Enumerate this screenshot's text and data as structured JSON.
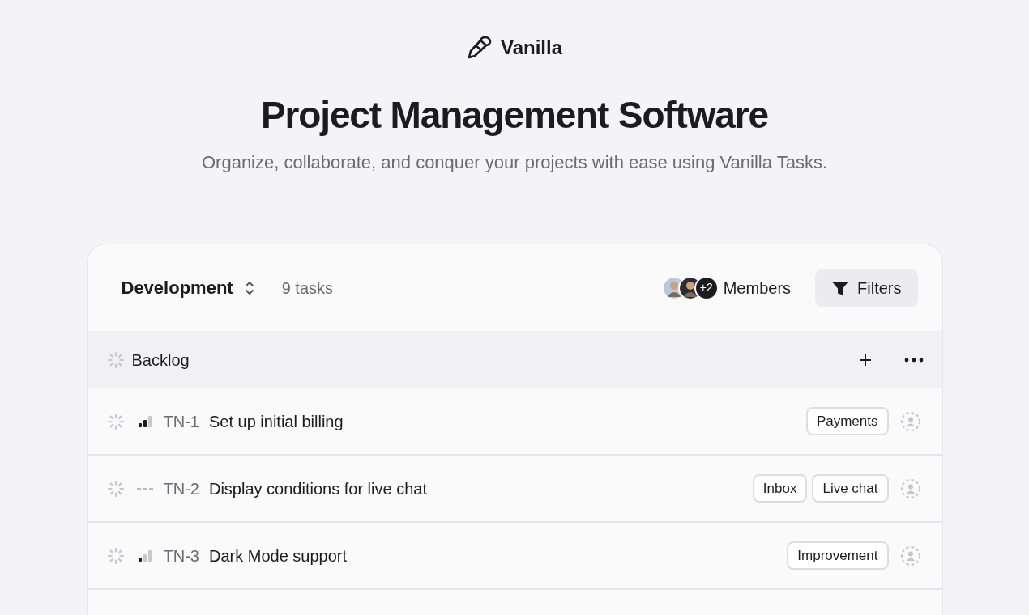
{
  "brand": {
    "name": "Vanilla"
  },
  "hero": {
    "title": "Project Management Software",
    "subtitle": "Organize, collaborate, and conquer your projects with ease using Vanilla Tasks."
  },
  "toolbar": {
    "project": "Development",
    "task_count": "9 tasks",
    "members_extra": "+2",
    "members_label": "Members",
    "filters_label": "Filters"
  },
  "group": {
    "name": "Backlog"
  },
  "tasks": [
    {
      "id": "TN-1",
      "title": "Set up initial billing",
      "kind": "medium",
      "tags": [
        "Payments"
      ]
    },
    {
      "id": "TN-2",
      "title": "Display conditions for live chat",
      "kind": "none",
      "tags": [
        "Inbox",
        "Live chat"
      ]
    },
    {
      "id": "TN-3",
      "title": "Dark Mode support",
      "kind": "low",
      "tags": [
        "Improvement"
      ]
    }
  ]
}
